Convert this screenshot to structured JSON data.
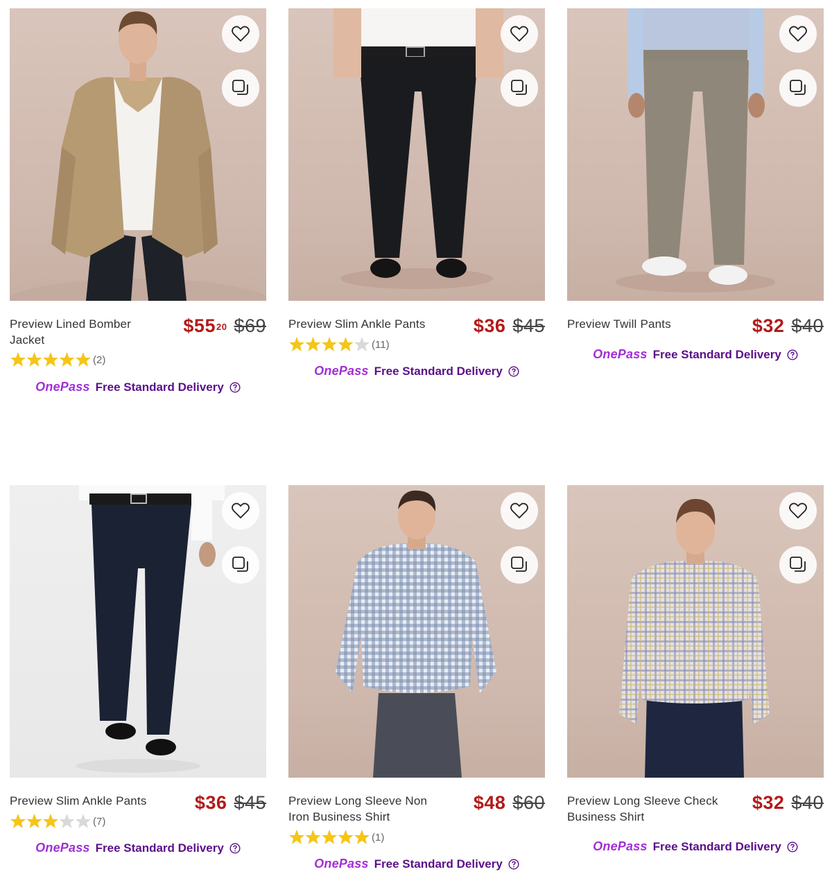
{
  "products": [
    {
      "name": "Preview Lined Bomber Jacket",
      "price_dollars": "$55",
      "price_cents": "20",
      "was_price": "$69",
      "rating": 5,
      "review_count": "(2)",
      "delivery_brand": "OnePass",
      "delivery_text": "Free Standard Delivery"
    },
    {
      "name": "Preview Slim Ankle Pants",
      "price_dollars": "$36",
      "price_cents": "",
      "was_price": "$45",
      "rating": 4.5,
      "review_count": "(11)",
      "delivery_brand": "OnePass",
      "delivery_text": "Free Standard Delivery"
    },
    {
      "name": "Preview Twill Pants",
      "price_dollars": "$32",
      "price_cents": "",
      "was_price": "$40",
      "rating": null,
      "review_count": "",
      "delivery_brand": "OnePass",
      "delivery_text": "Free Standard Delivery"
    },
    {
      "name": "Preview Slim Ankle Pants",
      "price_dollars": "$36",
      "price_cents": "",
      "was_price": "$45",
      "rating": 3.5,
      "review_count": "(7)",
      "delivery_brand": "OnePass",
      "delivery_text": "Free Standard Delivery"
    },
    {
      "name": "Preview Long Sleeve Non Iron Business Shirt",
      "price_dollars": "$48",
      "price_cents": "",
      "was_price": "$60",
      "rating": 5,
      "review_count": "(1)",
      "delivery_brand": "OnePass",
      "delivery_text": "Free Standard Delivery"
    },
    {
      "name": "Preview Long Sleeve Check Business Shirt",
      "price_dollars": "$32",
      "price_cents": "",
      "was_price": "$40",
      "rating": null,
      "review_count": "",
      "delivery_brand": "OnePass",
      "delivery_text": "Free Standard Delivery"
    }
  ],
  "icons": {
    "wishlist": "heart-icon",
    "compare": "compare-icon",
    "star": "star-icon",
    "help": "help-circle-icon"
  },
  "colors": {
    "sale_price": "#b31a1a",
    "star": "#f5c518",
    "star_empty": "#d9d9d9",
    "onepass": "#a12fd6",
    "delivery": "#5b0f8a"
  }
}
